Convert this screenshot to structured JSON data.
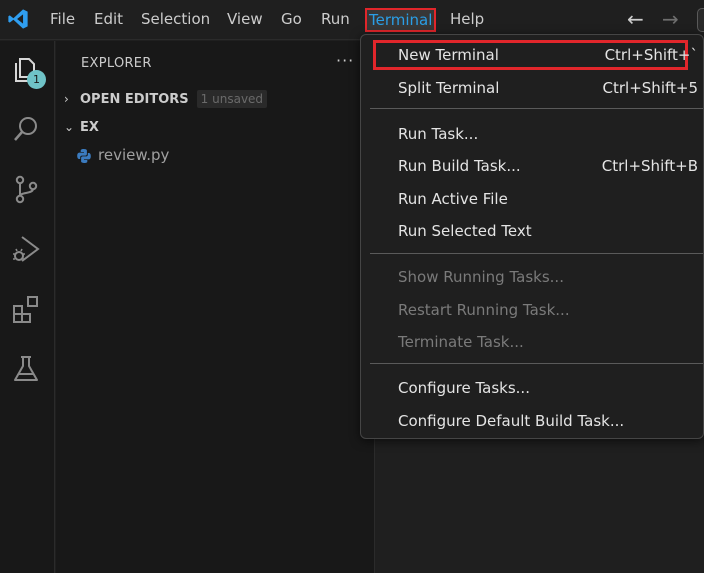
{
  "menubar": {
    "items": [
      {
        "label": "File"
      },
      {
        "label": "Edit"
      },
      {
        "label": "Selection"
      },
      {
        "label": "View"
      },
      {
        "label": "Go"
      },
      {
        "label": "Run"
      },
      {
        "label": "Terminal"
      },
      {
        "label": "Help"
      }
    ],
    "active": "Terminal",
    "back_arrow": "←",
    "forward_arrow": "→"
  },
  "activitybar": {
    "icons": [
      "explorer-icon",
      "search-icon",
      "source-control-icon",
      "run-debug-icon",
      "extensions-icon",
      "testing-icon"
    ],
    "explorer_badge": "1"
  },
  "sidebar": {
    "title": "EXPLORER",
    "more_actions": "···",
    "open_editors": {
      "label": "OPEN EDITORS",
      "chevron": "›",
      "badge": "1 unsaved"
    },
    "folder": {
      "label": "EX",
      "chevron": "⌄"
    },
    "files": [
      {
        "name": "review.py",
        "icon": "python-file-icon"
      }
    ]
  },
  "terminal_menu": {
    "items": [
      {
        "label": "New Terminal",
        "shortcut": "Ctrl+Shift+`",
        "enabled": true,
        "highlighted": true
      },
      {
        "label": "Split Terminal",
        "shortcut": "Ctrl+Shift+5",
        "enabled": true
      },
      {
        "label": "Run Task...",
        "shortcut": "",
        "enabled": true
      },
      {
        "label": "Run Build Task...",
        "shortcut": "Ctrl+Shift+B",
        "enabled": true
      },
      {
        "label": "Run Active File",
        "shortcut": "",
        "enabled": true
      },
      {
        "label": "Run Selected Text",
        "shortcut": "",
        "enabled": true
      },
      {
        "label": "Show Running Tasks...",
        "shortcut": "",
        "enabled": false
      },
      {
        "label": "Restart Running Task...",
        "shortcut": "",
        "enabled": false
      },
      {
        "label": "Terminate Task...",
        "shortcut": "",
        "enabled": false
      },
      {
        "label": "Configure Tasks...",
        "shortcut": "",
        "enabled": true
      },
      {
        "label": "Configure Default Build Task...",
        "shortcut": "",
        "enabled": true
      }
    ]
  },
  "colors": {
    "highlight_border": "#e1262b",
    "active_menu_text": "#2a9ee6",
    "badge": "#6fc3c7",
    "python_blue": "#3b7bbf"
  }
}
